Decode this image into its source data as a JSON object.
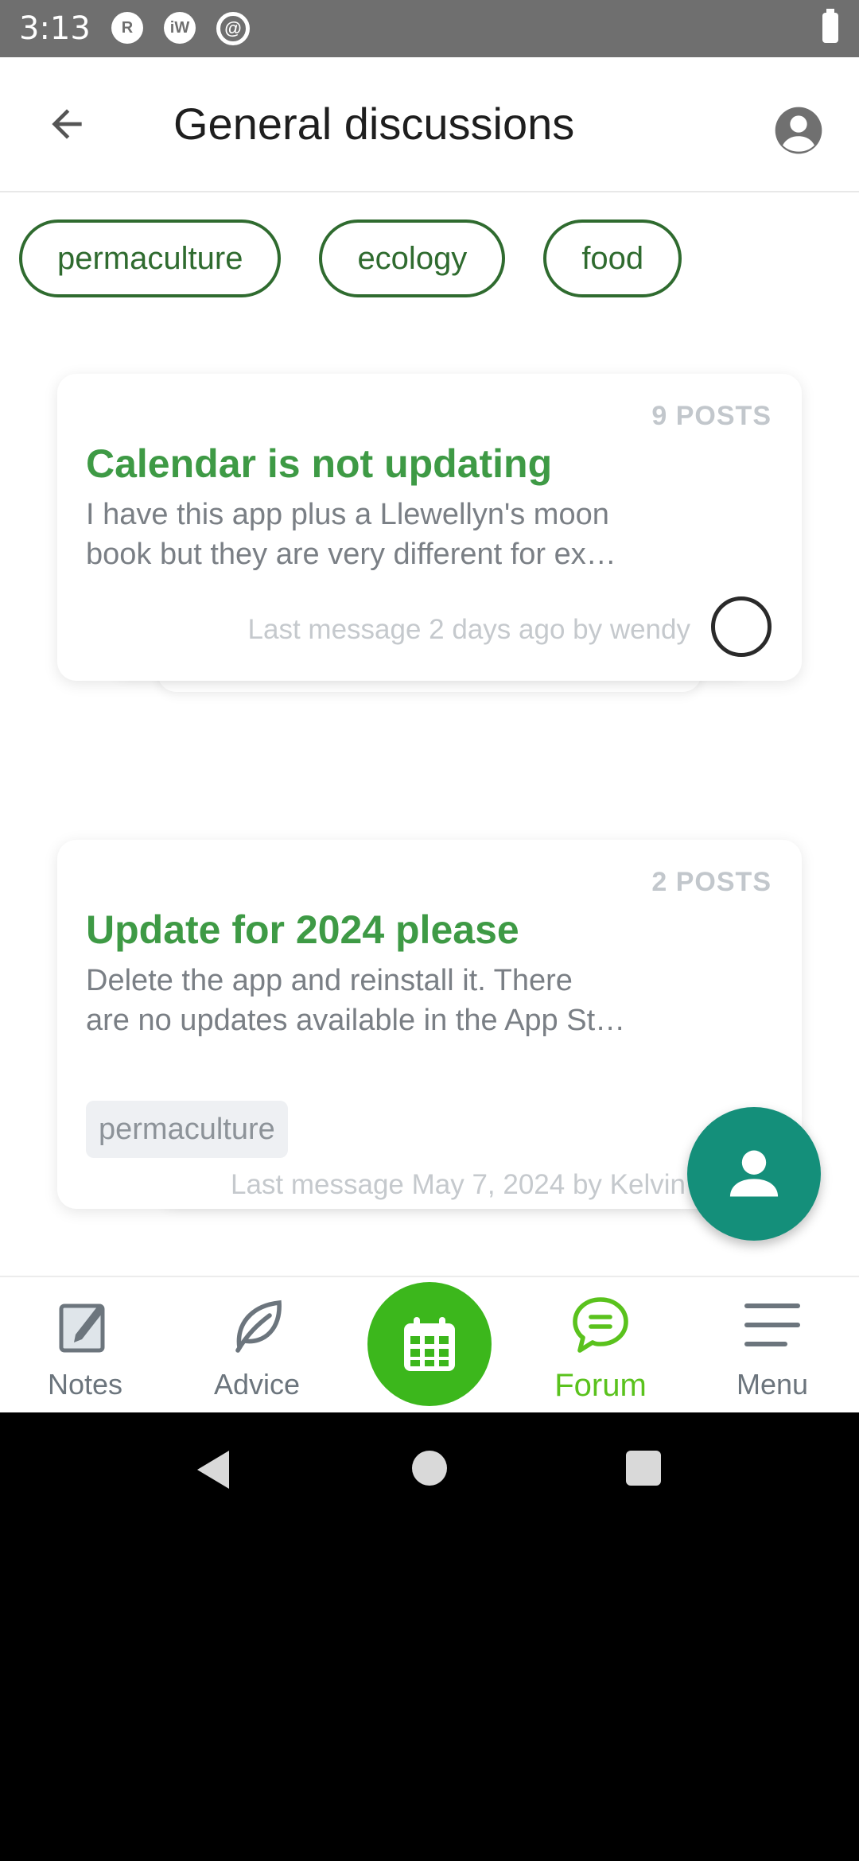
{
  "status_bar": {
    "time": "3:13",
    "icons": [
      "r-notification-icon",
      "iw-notification-icon",
      "at-sign-icon",
      "battery-charging-icon"
    ],
    "icon_letters": [
      "R",
      "iW",
      "@"
    ]
  },
  "header": {
    "title": "General discussions",
    "back_icon": "arrow-left-icon",
    "profile_icon": "account-circle-icon"
  },
  "tags": [
    "permaculture",
    "ecology",
    "food"
  ],
  "threads": [
    {
      "posts": "9 POSTS",
      "title": "Calendar is not updating",
      "snippet_line1": "I have this app plus a Llewellyn's moon",
      "snippet_line2": "book but they are very different for ex…",
      "meta": "Last message 2 days ago by wendy",
      "tag": ""
    },
    {
      "posts": "2 POSTS",
      "title": "Update for 2024 please",
      "snippet_line1": "Delete the app and reinstall it.   There",
      "snippet_line2": "are no updates available in the App St…",
      "meta": "Last message May 7, 2024 by Kelvin",
      "tag": "permaculture"
    }
  ],
  "bottom_nav": {
    "items": [
      {
        "label": "Notes",
        "icon": "notebook-pencil-icon"
      },
      {
        "label": "Advice",
        "icon": "leaf-icon"
      },
      {
        "label": "",
        "icon": "calendar-icon"
      },
      {
        "label": "Forum",
        "icon": "chat-bubble-icon"
      },
      {
        "label": "Menu",
        "icon": "hamburger-menu-icon"
      }
    ],
    "active": "Forum"
  },
  "colors": {
    "accent_green": "#3e9a45",
    "nav_active": "#5ac21d",
    "fab": "#148f7a",
    "tag_border": "#2f6b2f"
  }
}
